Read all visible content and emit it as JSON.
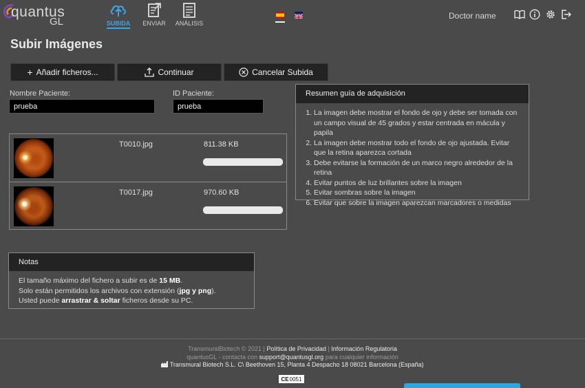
{
  "app": {
    "logo_word": "quantus",
    "logo_sub": "GL"
  },
  "nav": [
    {
      "label": "SUBIDA",
      "icon": "cloud-upload-icon",
      "active": true
    },
    {
      "label": "ENVIAR",
      "icon": "send-document-icon",
      "active": false
    },
    {
      "label": "ANÁLISIS",
      "icon": "analysis-document-icon",
      "active": false
    }
  ],
  "languages": [
    {
      "icon": "spain-flag-icon",
      "selected": true
    },
    {
      "icon": "uk-flag-icon",
      "selected": false
    }
  ],
  "user": {
    "name": "Doctor name"
  },
  "header_icons": [
    "manual-book-icon",
    "info-icon",
    "settings-gear-icon",
    "logout-icon"
  ],
  "page": {
    "title": "Subir Imágenes"
  },
  "actions": {
    "add_files": "Añadir ficheros...",
    "continue": "Continuar",
    "cancel": "Cancelar Subida"
  },
  "form": {
    "patient_name_label": "Nombre Paciente:",
    "patient_name_value": "prueba",
    "patient_id_label": "ID Paciente:",
    "patient_id_value": "prueba"
  },
  "files": [
    {
      "name": "T0010.jpg",
      "size": "811.38 KB",
      "progress": 1.0
    },
    {
      "name": "T0017.jpg",
      "size": "970.60 KB",
      "progress": 1.0
    }
  ],
  "guide": {
    "title": "Resumen guía de adquisición",
    "items": [
      "La imagen debe mostrar el fondo de ojo y debe ser tomada con un campo visual de 45 grados y estar centrada en mácula y papila",
      "La imagen debe mostrar todo el fondo de ojo ajustada. Evitar que la retina aparezca cortada",
      "Debe evitarse la formación de un marco negro alrededor de la retina",
      "Evitar puntos de luz brillantes sobre la imagen",
      "Evitar sombras sobre la imagen",
      "Evitar que sobre la imagen aparezcan marcadores o medidas"
    ]
  },
  "notes": {
    "title": "Notas",
    "line1_pre": "El tamaño máximo del fichero a subir es de ",
    "line1_bold": "15 MB",
    "line1_post": ".",
    "line2_pre": "Solo están permitidos los archivos con extensión (",
    "line2_bold": "jpg y png",
    "line2_post": ").",
    "line3_pre": "Usted puede ",
    "line3_bold": "arrastrar & soltar",
    "line3_post": " ficheros desde su PC."
  },
  "footer": {
    "copyright": "TransmuralBiotech © 2021",
    "sep": "|",
    "privacy": "Política de Privacidad",
    "regulatory": "Información Regulatoria",
    "contact_pre": "quantusGL - contacta con ",
    "contact_email": "support@quantusgl.org",
    "contact_post": " para cualquier información",
    "address": "Transmural Biotech S.L. C\\ Beethoven 15, Planta 4 Despacho 18 08021 Barcelona (España)",
    "ce_mark": "CE",
    "ce_number": "0051"
  },
  "colors": {
    "background": "#4b4a4a",
    "accent": "#3ea6e6",
    "panel_header": "#232323"
  }
}
